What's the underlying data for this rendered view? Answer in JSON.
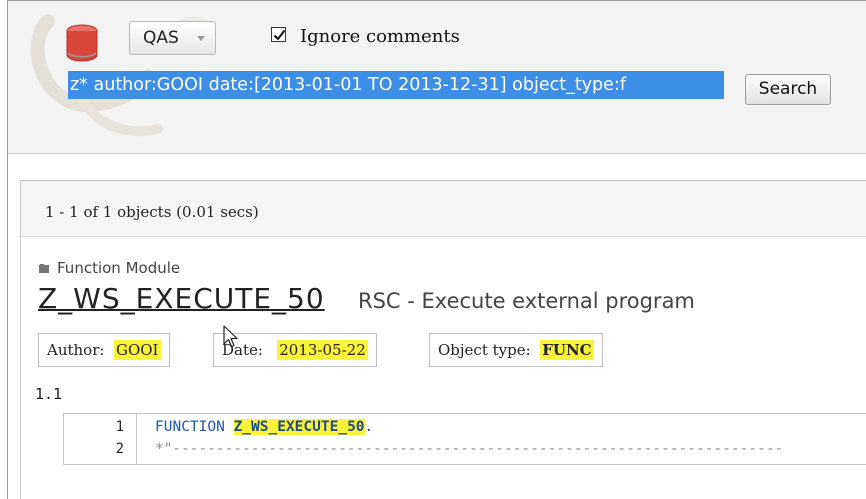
{
  "header": {
    "system_dropdown": {
      "selected": "QAS"
    },
    "ignore_comments": {
      "checked": true,
      "label": "Ignore comments"
    },
    "search": {
      "query": "z* author:GOOI date:[2013-01-01 TO 2013-12-31] object_type:f",
      "button_label": "Search"
    },
    "icons": [
      "database-icon",
      "chevron-down-icon",
      "checkbox-check-icon"
    ]
  },
  "results": {
    "summary": "1 - 1 of 1 objects (0.01 secs)",
    "items": [
      {
        "type_label": "Function Module",
        "name": "Z_WS_EXECUTE_50",
        "description": "RSC - Execute external program",
        "tags": [
          {
            "label": "Author:",
            "value": "GOOI"
          },
          {
            "label": "Date:",
            "value": "2013-05-22"
          },
          {
            "label": "Object type:",
            "value": "FUNC"
          }
        ],
        "section": "1.1",
        "code_lines": [
          {
            "number": "1",
            "keyword": "FUNCTION",
            "highlight": "Z_WS_EXECUTE_50",
            "rest": "."
          },
          {
            "number": "2",
            "text": "*\"----------------------------------------------------------------------"
          }
        ]
      }
    ]
  },
  "colors": {
    "highlight": "#fbf337",
    "selection": "#3d8ee6",
    "code_keyword": "#1d57b8"
  }
}
